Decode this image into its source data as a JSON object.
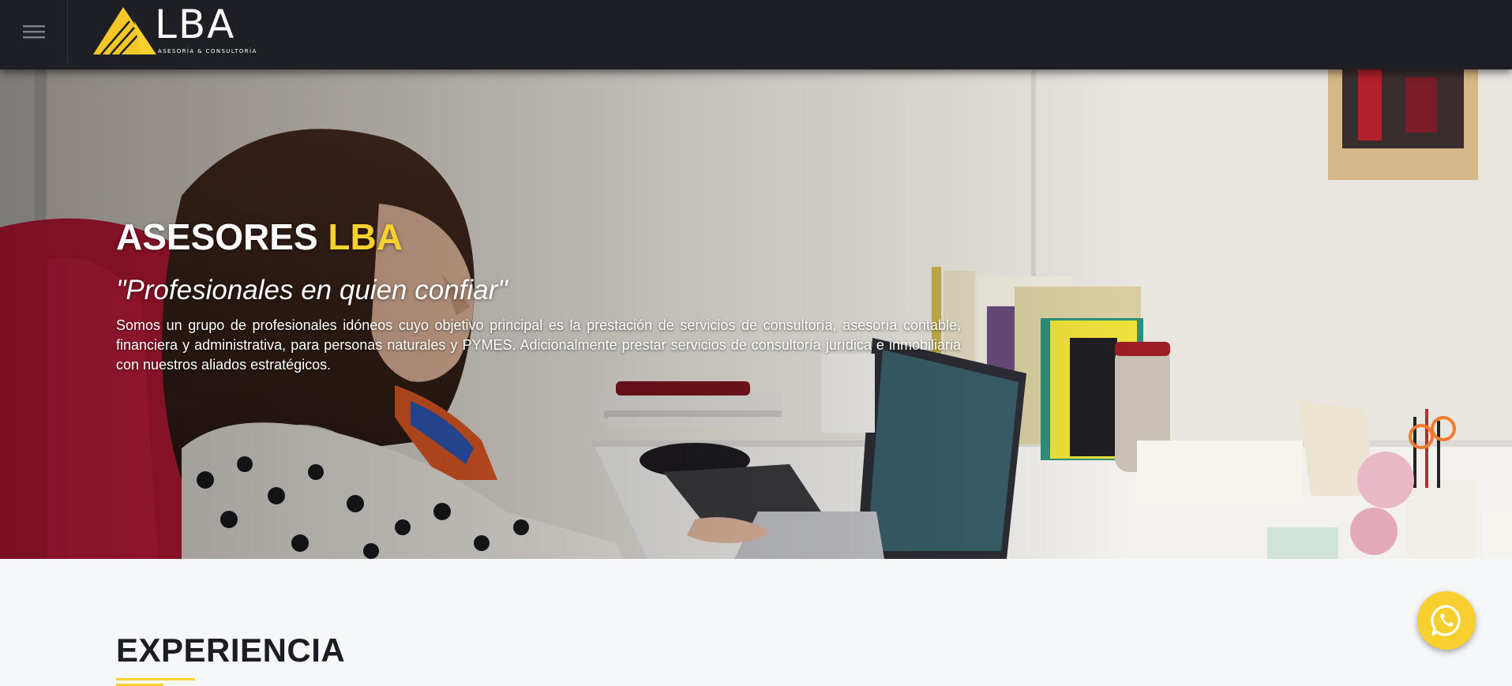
{
  "header": {
    "menu_icon": "hamburger-icon",
    "logo": {
      "wordmark": "LBA",
      "tagline": "ASESORÍA & CONSULTORÍA",
      "icon": "mountain-logo-icon"
    }
  },
  "hero": {
    "title_main": "ASESORES",
    "title_accent": "LBA",
    "quote": "\"Profesionales en quien confiar\"",
    "description": "Somos un grupo de profesionales idóneos cuyo objetivo principal es la prestación de servicios de consultoría, asesoría contable, financiera y administrativa, para personas naturales y PYMES. Adicionalmente prestar servicios de consultoría jurídica e inmobiliaria con nuestros aliados estratégicos."
  },
  "section": {
    "title": "EXPERIENCIA"
  },
  "floating": {
    "whatsapp_icon": "whatsapp-icon"
  },
  "colors": {
    "accent": "#f7d02f",
    "header_bg": "#1e1f24",
    "page_bg": "#f6f7f9",
    "text_dark": "#1c1d22"
  }
}
